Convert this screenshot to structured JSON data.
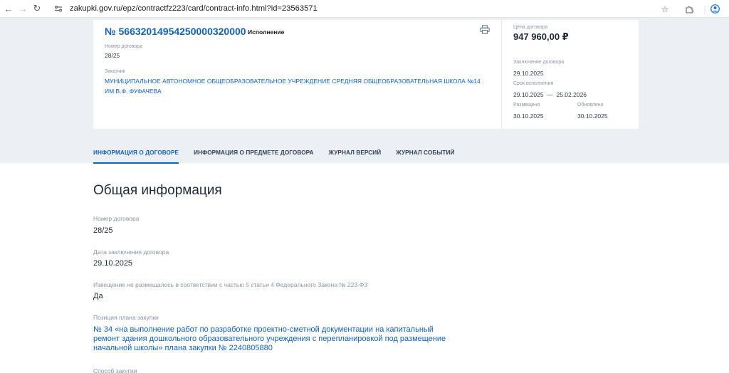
{
  "browser": {
    "url": "zakupki.gov.ru/epz/contractfz223/card/contract-info.html?id=23563571"
  },
  "card": {
    "contract_number": "№ 56632014954250000320000",
    "status": "Исполнение",
    "number_label": "Номер договора",
    "number_value": "28/25",
    "customer_label": "Заказчик",
    "customer_line1": "МУНИЦИПАЛЬНОЕ АВТОНОМНОЕ ОБЩЕОБРАЗОВАТЕЛЬНОЕ УЧРЕЖДЕНИЕ СРЕДНЯЯ ОБЩЕОБРАЗОВАТЕЛЬНАЯ ШКОЛА №14",
    "customer_line2": "ИМ.В.Ф. ФУФАЧЕВА",
    "price_label": "Цена договора",
    "price_value": "947 960,00 ₽",
    "conclusion_label": "Заключение договора",
    "conclusion_value": "29.10.2025",
    "term_label": "Срок исполнения",
    "term_value": "29.10.2025  —  25.02.2026",
    "placed_label": "Размещено",
    "placed_value": "30.10.2025",
    "updated_label": "Обновлено",
    "updated_value": "30.10.2025"
  },
  "tabs": [
    {
      "label": "ИНФОРМАЦИЯ О ДОГОВОРЕ",
      "active": true
    },
    {
      "label": "ИНФОРМАЦИЯ О ПРЕДМЕТЕ ДОГОВОРА",
      "active": false
    },
    {
      "label": "ЖУРНАЛ ВЕРСИЙ",
      "active": false
    },
    {
      "label": "ЖУРНАЛ СОБЫТИЙ",
      "active": false
    }
  ],
  "general": {
    "title": "Общая информация",
    "fields": [
      {
        "label": "Номер договора",
        "value": "28/25"
      },
      {
        "label": "Дата заключения договора",
        "value": "29.10.2025"
      },
      {
        "label": "Извещение не размещалось в соответствии с частью 5 статьи 4 Федерального Закона № 223-ФЗ",
        "value": "Да"
      },
      {
        "label": "Позиция плана закупки",
        "value_lines": [
          "№ 34 «на выполнение работ по разработке проектно-сметной документации на капитальный",
          "ремонт здания дошкольного образовательного учреждения с перепланировкой под размещение",
          "начальной школы» плана закупки № 2240805880"
        ]
      },
      {
        "label": "Способ закупки"
      }
    ]
  }
}
